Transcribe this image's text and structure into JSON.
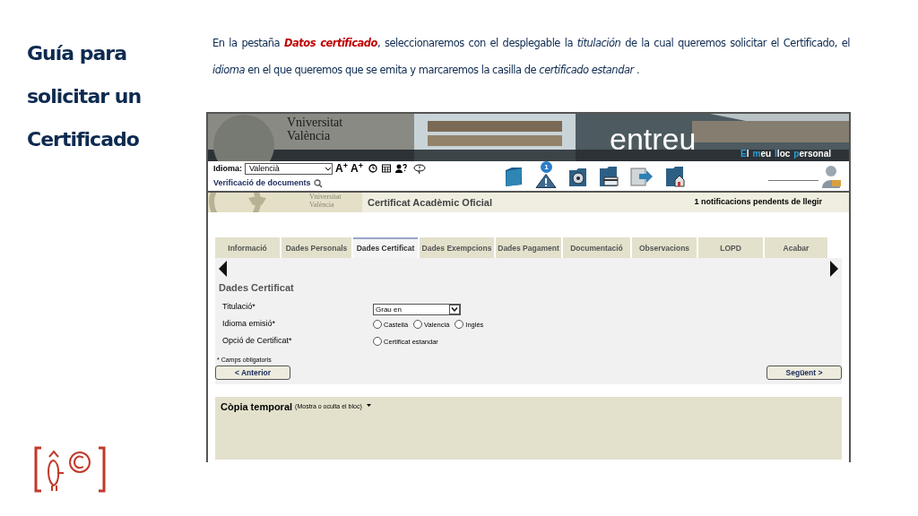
{
  "slide": {
    "title_lines": [
      "Guía para",
      "solicitar un",
      "Certificado"
    ],
    "description": [
      {
        "kind": "plain",
        "text": "En la pestaña "
      },
      {
        "kind": "highlight",
        "text": "Datos certificado"
      },
      {
        "kind": "plain",
        "text": ", seleccionaremos con el desplegable la "
      },
      {
        "kind": "italic",
        "text": "titulación"
      },
      {
        "kind": "plain",
        "text": " de la cual queremos solicitar el Certificado, el "
      },
      {
        "kind": "italic",
        "text": "idioma"
      },
      {
        "kind": "plain",
        "text": " en el que queremos que se emita y marcaremos la casilla de "
      },
      {
        "kind": "italic",
        "text": "certificado estandar"
      },
      {
        "kind": "plain",
        "text": " ."
      }
    ]
  },
  "screen": {
    "banner": {
      "logo_lines": [
        "Vniversitat",
        "València"
      ],
      "brand": "entreu",
      "tagline": [
        "El",
        "meu",
        "lloc",
        "personal"
      ]
    },
    "toolbar": {
      "language_label": "Idioma:",
      "language_value": "Valencià",
      "font_buttons": [
        "A$^{+}$",
        "A$^{+}$"
      ],
      "verification_link": "Verificació de documents",
      "notification_badge": "1"
    },
    "app_header": {
      "logo_lines": [
        "Vniversitat",
        "València"
      ],
      "title": "Certificat Acadèmic Oficial",
      "notifications": "1 notificacions pendents de llegir"
    },
    "tabs": [
      {
        "label": "Informació",
        "selected": false
      },
      {
        "label": "Dades Personals",
        "selected": false
      },
      {
        "label": "Dades Certificat",
        "selected": true
      },
      {
        "label": "Dades Exempcions",
        "selected": false
      },
      {
        "label": "Dades Pagament",
        "selected": false
      },
      {
        "label": "Documentació",
        "selected": false
      },
      {
        "label": "Observacions",
        "selected": false
      },
      {
        "label": "LOPD",
        "selected": false
      },
      {
        "label": "Acabar",
        "selected": false
      }
    ],
    "form": {
      "heading": "Dades Certificat",
      "fields": [
        {
          "kind": "select",
          "label": "Titulació*",
          "value": "Grau en"
        },
        {
          "kind": "radio",
          "label": "Idioma emisió*",
          "options": [
            {
              "label": "Castellà",
              "selected": false
            },
            {
              "label": "Valencià",
              "selected": false
            },
            {
              "label": "Inglés",
              "selected": false
            }
          ]
        },
        {
          "kind": "radio",
          "label": "Opció de Certificat*",
          "options": [
            {
              "label": "Certificat estandar",
              "selected": false
            }
          ]
        }
      ],
      "note": "* Camps obligatoris",
      "previous_button": "< Anterior",
      "next_button": "Següent >"
    },
    "collapsible": {
      "title": "Còpia temporal",
      "hint": "(Mostra o oculta el bloc)"
    }
  }
}
